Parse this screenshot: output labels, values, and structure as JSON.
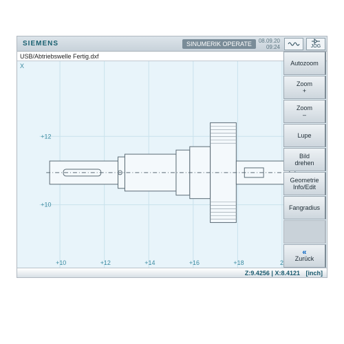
{
  "header": {
    "brand": "SIEMENS",
    "product": "SINUMERIK OPERATE",
    "date": "08.09.20",
    "time": "09:24",
    "mode": "JOG"
  },
  "filebar": {
    "path": "USB/Abtriebswelle Fertig.dxf"
  },
  "workspace": {
    "axis_vertical": "X",
    "y_ticks": [
      "+12",
      "+10"
    ],
    "x_ticks": [
      "+10",
      "+12",
      "+14",
      "+16",
      "+18",
      "2"
    ]
  },
  "statusbar": {
    "z_label": "Z:",
    "z_value": "9.4256",
    "sep": " | ",
    "x_label": "X:",
    "x_value": "8.4121",
    "unit": "[inch]"
  },
  "sidebar": {
    "autozoom": "Autozoom",
    "zoom_in": "Zoom\n+",
    "zoom_out": "Zoom\n–",
    "lupe": "Lupe",
    "bild_drehen": "Bild\ndrehen",
    "geom": "Geometrie\nInfo/Edit",
    "fangradius": "Fangradius",
    "back": "Zurück"
  }
}
